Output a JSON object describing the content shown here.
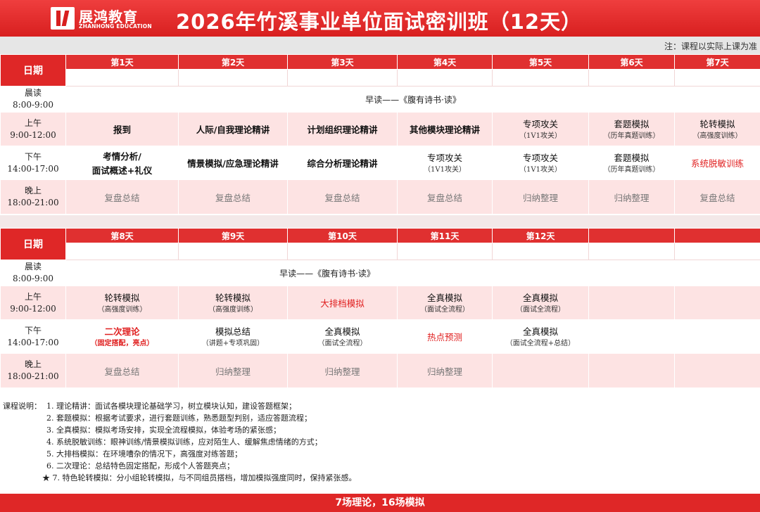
{
  "brand": {
    "name_cn": "展鸿教育",
    "name_en": "ZHANHONG EDUCATION"
  },
  "title": "2026年竹溪事业单位面试密训班（12天）",
  "note": "注：课程以实际上课为准",
  "date_label": "日期",
  "block1": {
    "days": [
      "第1天",
      "第2天",
      "第3天",
      "第4天",
      "第5天",
      "第6天",
      "第7天"
    ],
    "early": {
      "label1": "晨读",
      "label2": "8:00-9:00",
      "content": "早读——《腹有诗书·读》"
    },
    "am": {
      "label1": "上午",
      "label2": "9:00-12:00",
      "cells": [
        {
          "main": "报到",
          "sub": ""
        },
        {
          "main": "人际/自我理论精讲",
          "sub": ""
        },
        {
          "main": "计划组织理论精讲",
          "sub": ""
        },
        {
          "main": "其他模块理论精讲",
          "sub": ""
        },
        {
          "main": "专项攻关",
          "sub": "（1V1攻关）"
        },
        {
          "main": "套题模拟",
          "sub": "（历年真题训练）"
        },
        {
          "main": "轮转模拟",
          "sub": "（高强度训练）"
        }
      ]
    },
    "pm": {
      "label1": "下午",
      "label2": "14:00-17:00",
      "cells": [
        {
          "main": "考情分析/",
          "main2": "面试概述+礼仪",
          "sub": ""
        },
        {
          "main": "情景模拟/应急理论精讲",
          "sub": ""
        },
        {
          "main": "综合分析理论精讲",
          "sub": ""
        },
        {
          "main": "专项攻关",
          "sub": "（1V1攻关）"
        },
        {
          "main": "专项攻关",
          "sub": "（1V1攻关）"
        },
        {
          "main": "套题模拟",
          "sub": "（历年真题训练）"
        },
        {
          "main": "系统脱敏训练",
          "sub": ""
        }
      ]
    },
    "eve": {
      "label1": "晚上",
      "label2": "18:00-21:00",
      "cells": [
        "复盘总结",
        "复盘总结",
        "复盘总结",
        "复盘总结",
        "归纳整理",
        "归纳整理",
        "复盘总结"
      ]
    }
  },
  "block2": {
    "days": [
      "第8天",
      "第9天",
      "第10天",
      "第11天",
      "第12天",
      "",
      ""
    ],
    "early": {
      "label1": "晨读",
      "label2": "8:00-9:00",
      "content": "早读——《腹有诗书·读》"
    },
    "am": {
      "label1": "上午",
      "label2": "9:00-12:00",
      "cells": [
        {
          "main": "轮转模拟",
          "sub": "（高强度训练）"
        },
        {
          "main": "轮转模拟",
          "sub": "（高强度训练）"
        },
        {
          "main": "大排档模拟",
          "sub": ""
        },
        {
          "main": "全真模拟",
          "sub": "（面试全流程）"
        },
        {
          "main": "全真模拟",
          "sub": "（面试全流程）"
        },
        {
          "main": "",
          "sub": ""
        },
        {
          "main": "",
          "sub": ""
        }
      ]
    },
    "pm": {
      "label1": "下午",
      "label2": "14:00-17:00",
      "cells": [
        {
          "main": "二次理论",
          "sub": "（固定搭配，亮点）"
        },
        {
          "main": "模拟总结",
          "sub": "（讲题+专项巩固）"
        },
        {
          "main": "全真模拟",
          "sub": "（面试全流程）"
        },
        {
          "main": "热点预测",
          "sub": ""
        },
        {
          "main": "全真模拟",
          "sub": "（面试全流程+总结）"
        },
        {
          "main": "",
          "sub": ""
        },
        {
          "main": "",
          "sub": ""
        }
      ]
    },
    "eve": {
      "label1": "晚上",
      "label2": "18:00-21:00",
      "cells": [
        "复盘总结",
        "归纳整理",
        "归纳整理",
        "归纳整理",
        "",
        "",
        ""
      ]
    }
  },
  "legend": {
    "prefix": "课程说明：",
    "items": [
      "1. 理论精讲：面试各模块理论基础学习，树立模块认知，建设答题框架；",
      "2. 套题模拟：根据考试要求，进行套题训练，熟悉题型判别，适应答题流程；",
      "3. 全真模拟：模拟考场安排，实现全流程模拟，体验考场的紧张感；",
      "4. 系统脱敏训练：眼神训练/情景模拟训练，应对陌生人、缓解焦虑情绪的方式；",
      "5. 大排档模拟：在环境嘈杂的情况下，高强度对练答题；",
      "6. 二次理论：总结特色固定搭配，形成个人答题亮点；",
      "★ 7. 特色轮转模拟：分小组轮转模拟，与不同组员搭档，增加模拟强度同时，保持紧张感。"
    ]
  },
  "footer": "7场理论，16场模拟",
  "colors": {
    "brand_red": "#df2727",
    "pink_row": "#fde3e3",
    "highlight_red": "#e02020"
  }
}
